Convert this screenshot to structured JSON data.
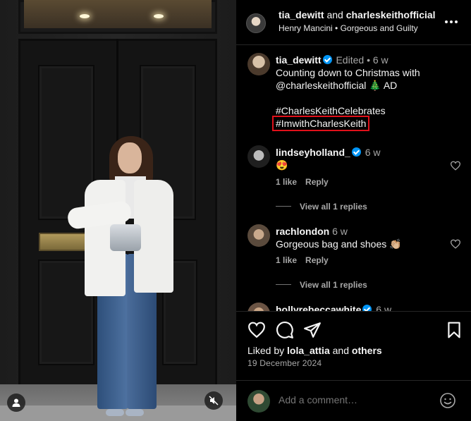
{
  "post": {
    "header": {
      "author_1": "tia_dewitt",
      "joiner": "and",
      "author_2": "charleskeithofficial",
      "audio_artist": "Henry Mancini",
      "bullet": "•",
      "audio_title": "Gorgeous and Guilty"
    },
    "caption": {
      "user": "tia_dewitt",
      "edited": "Edited",
      "bullet": "•",
      "age": "6 w",
      "line1": "Counting down to Christmas with",
      "line2": "@charleskeithofficial",
      "line2_emoji": "🎄",
      "line2_tail": "AD",
      "tag1": "#CharlesKeithCelebrates",
      "tag2": "#ImwithCharlesKeith"
    },
    "comments": [
      {
        "user": "lindseyholland_",
        "verified": true,
        "age": "6 w",
        "text": "😍",
        "likes": "1 like",
        "reply": "Reply",
        "view_replies": "View all 1 replies"
      },
      {
        "user": "rachlondon",
        "verified": false,
        "age": "6 w",
        "text": "Gorgeous bag and shoes 👏🏼",
        "likes": "1 like",
        "reply": "Reply",
        "view_replies": "View all 1 replies"
      },
      {
        "user": "hollyrebeccawhite",
        "verified": true,
        "age": "6 w"
      }
    ],
    "liked_prefix": "Liked by",
    "liked_user": "lola_attia",
    "liked_joiner": "and",
    "liked_others": "others",
    "date": "19 December 2024",
    "comment_placeholder": "Add a comment…"
  },
  "icons": {
    "user_tag": "user-tag-icon",
    "mute": "mute-icon",
    "heart": "heart-icon",
    "comment": "comment-icon",
    "share": "share-icon",
    "save": "bookmark-icon",
    "more": "more-icon",
    "emoji": "emoji-icon"
  },
  "colors": {
    "background": "#000000",
    "text": "#f5f5f5",
    "secondary": "#a8a8a8",
    "verified": "#0095f6",
    "highlight_box": "#e0101a"
  }
}
